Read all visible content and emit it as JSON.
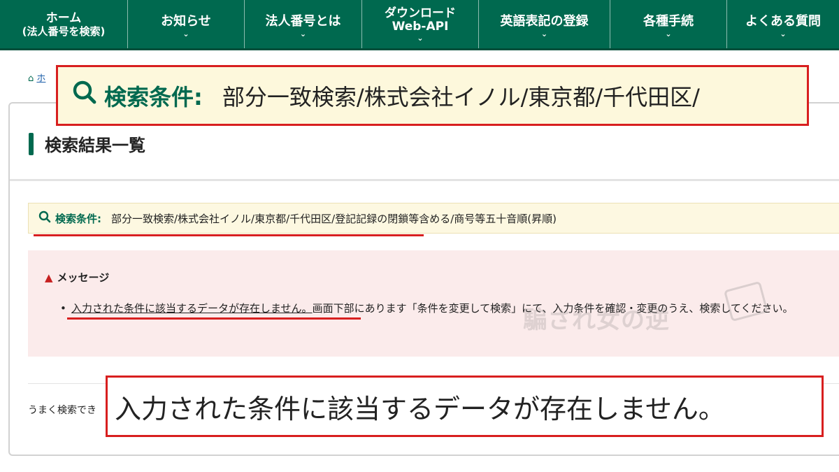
{
  "nav": {
    "items": [
      {
        "l1": "ホーム",
        "l2": "(法人番号を検索)",
        "chev": ""
      },
      {
        "l1": "お知らせ",
        "l2": "",
        "chev": "⌄"
      },
      {
        "l1": "法人番号とは",
        "l2": "",
        "chev": "⌄"
      },
      {
        "l1": "ダウンロード",
        "l2": "Web-API",
        "chev": "⌄"
      },
      {
        "l1": "英語表記の登録",
        "l2": "",
        "chev": "⌄"
      },
      {
        "l1": "各種手続",
        "l2": "",
        "chev": "⌄"
      },
      {
        "l1": "よくある質問",
        "l2": "",
        "chev": "⌄"
      }
    ]
  },
  "breadcrumb": {
    "home_icon": "⌂",
    "home_label": "ホ"
  },
  "page_title": "検索結果一覧",
  "conditions": {
    "icon": "search-icon",
    "label": "検索条件:",
    "value": "部分一致検索/株式会社イノル/東京都/千代田区/登記記録の閉鎖等含める/商号等五十音順(昇順)"
  },
  "message": {
    "title": "メッセージ",
    "bullet": "•",
    "underlined": "入力された条件に該当するデータが存在しません。",
    "rest": "画面下部にあります「条件を変更して検索」にて、入力条件を確認・変更のうえ、検索してください。"
  },
  "hint": "うまく検索でき",
  "watermark": "騙され女の逆",
  "zoom_conditions": {
    "label": "検索条件:",
    "value": "部分一致検索/株式会社イノル/東京都/千代田区/"
  },
  "zoom_message": "入力された条件に該当するデータが存在しません。",
  "colors": {
    "brand": "#00694f",
    "highlight": "#d81f1f",
    "cond_bg": "#fdf8e1",
    "msg_bg": "#fbebeb"
  }
}
